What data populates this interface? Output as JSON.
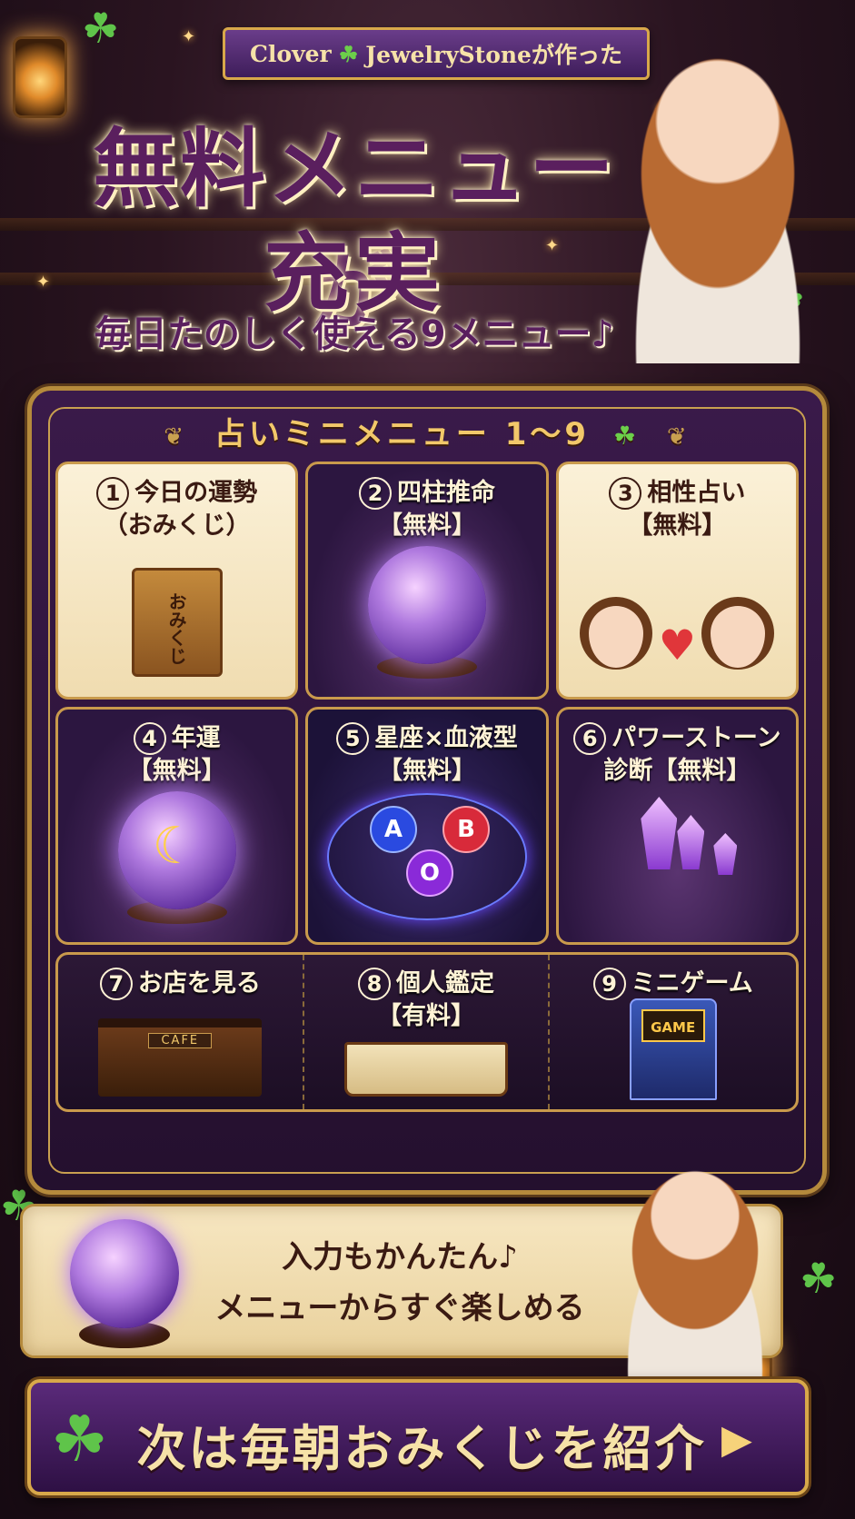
{
  "header": {
    "ribbon_text": "Clover JewelryStoneが作った",
    "ribbon_prefix": "Clover",
    "ribbon_suffix": "JewelryStoneが作った",
    "title_line1": "無料メニューが",
    "title_line2": "充実",
    "subtitle": "毎日たのしく使える9メニュー♪"
  },
  "panel": {
    "title": "占いミニメニュー 1〜9",
    "items": [
      {
        "num": "1",
        "label": "今日の運勢",
        "label2": "（おみくじ）",
        "art_text": "おみくじ"
      },
      {
        "num": "2",
        "label": "四柱推命",
        "label2": "【無料】"
      },
      {
        "num": "3",
        "label": "相性占い",
        "label2": "【無料】"
      },
      {
        "num": "4",
        "label": "年運",
        "label2": "【無料】"
      },
      {
        "num": "5",
        "label": "星座×血液型",
        "label2": "【無料】",
        "blood_types": [
          "A",
          "B",
          "O"
        ]
      },
      {
        "num": "6",
        "label": "パワーストーン",
        "label2": "診断【無料】"
      },
      {
        "num": "7",
        "label": "お店を見る",
        "label2": "",
        "art_text": "CAFE"
      },
      {
        "num": "8",
        "label": "個人鑑定",
        "label2": "【有料】"
      },
      {
        "num": "9",
        "label": "ミニゲーム",
        "label2": "",
        "art_text": "GAME"
      }
    ]
  },
  "scroll": {
    "line1": "入力もかんたん♪",
    "line2": "メニューからすぐ楽しめる"
  },
  "footer": {
    "cta_text": "次は毎朝おみくじを紹介"
  },
  "colors": {
    "title_purple": "#5a1f5e",
    "gold": "#d8a84a",
    "panel_bg": "#3a1a4a",
    "clover_green": "#5fc44a"
  },
  "icons": [
    "clover-icon",
    "crystal-ball-icon",
    "moon-icon",
    "heart-icon",
    "arrow-right-icon",
    "lantern-icon",
    "sparkle-icon"
  ]
}
